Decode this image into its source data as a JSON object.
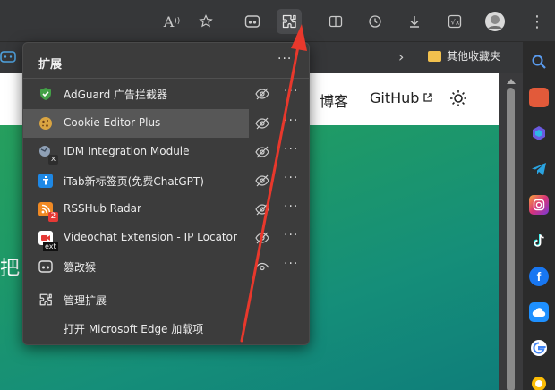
{
  "toolbar": {
    "icons": [
      "read-aloud-icon",
      "favorite-star-icon",
      "extension-puzzle-icon",
      "split-screen-icon",
      "history-icon",
      "download-icon",
      "formula-icon",
      "profile-avatar-icon",
      "more-menu-icon"
    ],
    "read_aloud_glyph": "A",
    "more_glyph": "⋮"
  },
  "bookmarks": {
    "folder_label": "其他收藏夹",
    "chevron": "›"
  },
  "page": {
    "nav_items": [
      "博客",
      "GitHub"
    ],
    "body_char": "把",
    "gradient": [
      "#29a15a",
      "#0f7e7a"
    ]
  },
  "extensions_panel": {
    "title": "扩展",
    "menu_glyph": "···",
    "items": [
      {
        "label": "AdGuard 广告拦截器",
        "icon": "adguard-shield-icon",
        "color": "#43a047",
        "badge": ""
      },
      {
        "label": "Cookie Editor Plus",
        "icon": "cookie-icon",
        "color": "#d9a441",
        "badge": ""
      },
      {
        "label": "IDM Integration Module",
        "icon": "idm-globe-icon",
        "color": "#6b7a8f",
        "badge": "x"
      },
      {
        "label": "iTab新标签页(免费ChatGPT)",
        "icon": "itab-icon",
        "color": "#1e88e5",
        "badge": ""
      },
      {
        "label": "RSSHub Radar",
        "icon": "rsshub-icon",
        "color": "#f08a24",
        "badge": "2"
      },
      {
        "label": "Videochat Extension - IP Locator f...",
        "icon": "videochat-icon",
        "color": "#222222",
        "badge": "ext"
      },
      {
        "label": "篡改猴",
        "icon": "tampermonkey-icon",
        "color": "#333333",
        "badge": ""
      }
    ],
    "footer": [
      {
        "label": "管理扩展",
        "icon": "manage-puzzle-icon"
      },
      {
        "label": "打开 Microsoft Edge 加载项",
        "icon": ""
      }
    ]
  },
  "sidebar": {
    "icons": [
      {
        "name": "search-icon",
        "color": "#3a7bd5"
      },
      {
        "name": "toolbox-icon",
        "color": "#e25a3a"
      },
      {
        "name": "copilot-icon",
        "color": "#6a5ae0"
      },
      {
        "name": "telegram-icon",
        "color": "#2aa3e0"
      },
      {
        "name": "instagram-icon",
        "color": "#d6337a"
      },
      {
        "name": "tiktok-icon",
        "color": "#111111"
      },
      {
        "name": "facebook-icon",
        "color": "#1877f2"
      },
      {
        "name": "cloud-icon",
        "color": "#1e90ff"
      },
      {
        "name": "google-icon",
        "color": "#ffffff"
      }
    ]
  },
  "colors": {
    "annotation_arrow": "#e8382c",
    "panel_bg": "#3c3c3c"
  }
}
